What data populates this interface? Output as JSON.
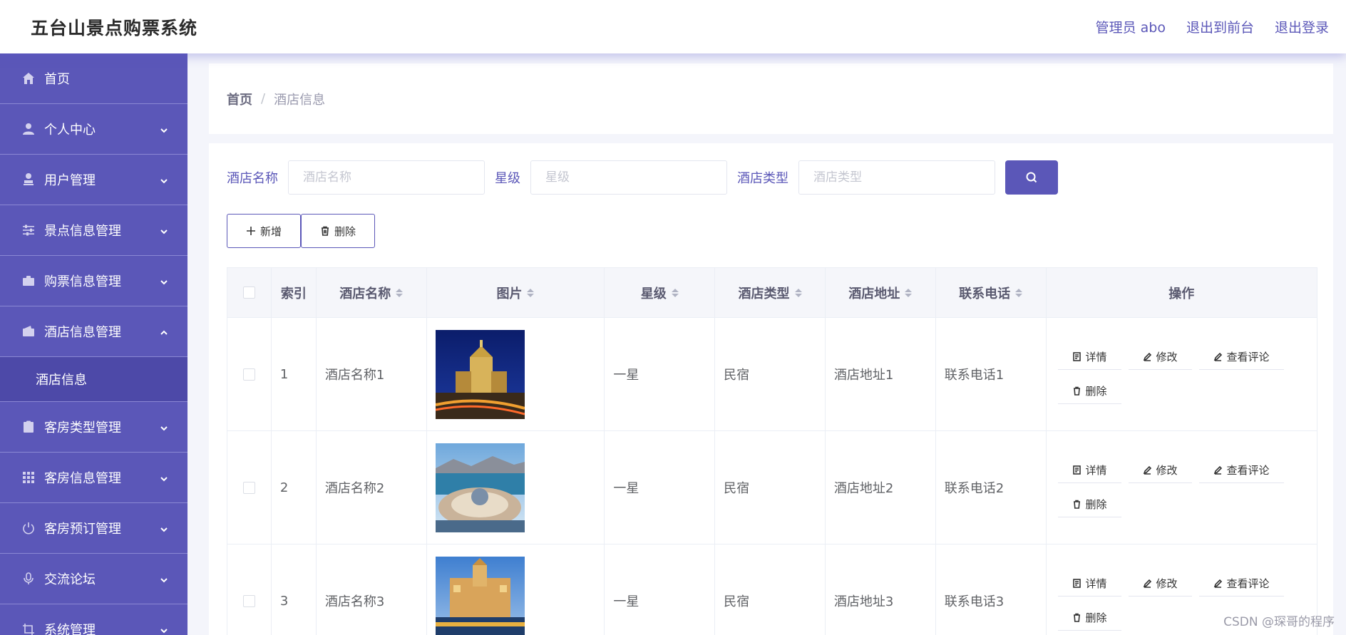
{
  "app": {
    "title": "五台山景点购票系统",
    "admin_label": "管理员 abo",
    "back_front": "退出到前台",
    "logout": "退出登录"
  },
  "sidebar": {
    "items": [
      {
        "label": "首页",
        "icon": "home-icon"
      },
      {
        "label": "个人中心",
        "icon": "person-icon"
      },
      {
        "label": "用户管理",
        "icon": "user-stamp-icon"
      },
      {
        "label": "景点信息管理",
        "icon": "sliders-icon"
      },
      {
        "label": "购票信息管理",
        "icon": "briefcase-icon"
      },
      {
        "label": "酒店信息管理",
        "icon": "wallet-icon"
      },
      {
        "label": "客房类型管理",
        "icon": "clipboard-icon"
      },
      {
        "label": "客房信息管理",
        "icon": "grid-icon"
      },
      {
        "label": "客房预订管理",
        "icon": "power-icon"
      },
      {
        "label": "交流论坛",
        "icon": "microphone-icon"
      },
      {
        "label": "系统管理",
        "icon": "crop-icon"
      }
    ],
    "active_sub": "酒店信息"
  },
  "breadcrumb": {
    "home": "首页",
    "separator": "/",
    "current": "酒店信息"
  },
  "search": {
    "name_label": "酒店名称",
    "name_placeholder": "酒店名称",
    "star_label": "星级",
    "star_placeholder": "星级",
    "type_label": "酒店类型",
    "type_placeholder": "酒店类型"
  },
  "actions": {
    "add": "新增",
    "delete": "删除"
  },
  "table": {
    "headers": [
      "索引",
      "酒店名称",
      "图片",
      "星级",
      "酒店类型",
      "酒店地址",
      "联系电话",
      "操作"
    ],
    "rows": [
      {
        "index": "1",
        "name": "酒店名称1",
        "star": "一星",
        "type": "民宿",
        "address": "酒店地址1",
        "phone": "联系电话1"
      },
      {
        "index": "2",
        "name": "酒店名称2",
        "star": "一星",
        "type": "民宿",
        "address": "酒店地址2",
        "phone": "联系电话2"
      },
      {
        "index": "3",
        "name": "酒店名称3",
        "star": "一星",
        "type": "民宿",
        "address": "酒店地址3",
        "phone": "联系电话3"
      }
    ],
    "row_ops": {
      "detail": "详情",
      "edit": "修改",
      "comments": "查看评论",
      "delete": "删除"
    }
  },
  "watermark": "CSDN @琛哥的程序",
  "colors": {
    "primary": "#5b57b8",
    "sidebar_active": "#4d49a8"
  }
}
